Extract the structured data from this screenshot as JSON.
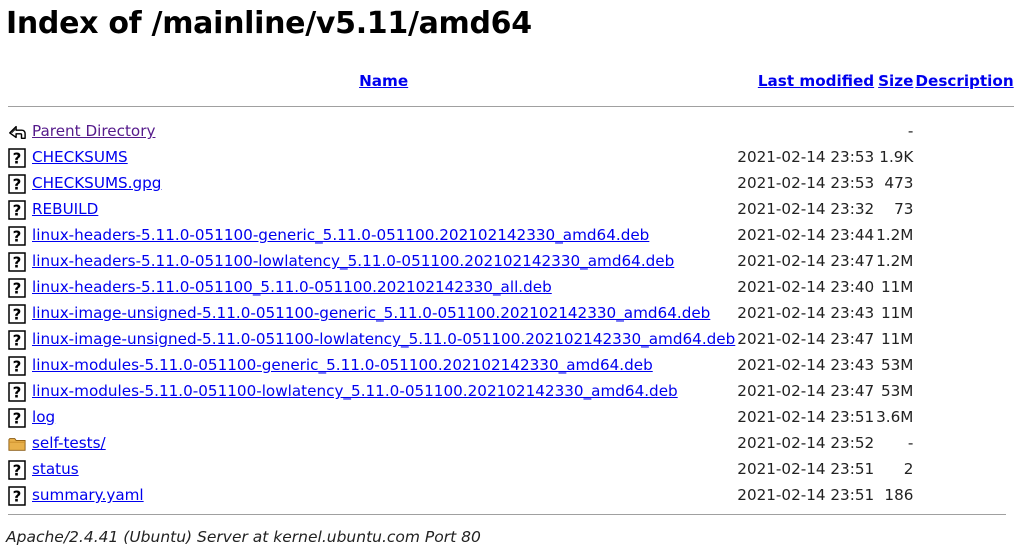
{
  "page": {
    "title": "Index of /mainline/v5.11/amd64"
  },
  "headers": {
    "name": "Name",
    "last_modified": "Last modified",
    "size": "Size",
    "description": "Description"
  },
  "rows": [
    {
      "icon": "back-icon",
      "name": "Parent Directory",
      "modified": "",
      "size": "-"
    },
    {
      "icon": "unknown-file-icon",
      "name": "CHECKSUMS",
      "modified": "2021-02-14 23:53",
      "size": "1.9K"
    },
    {
      "icon": "unknown-file-icon",
      "name": "CHECKSUMS.gpg",
      "modified": "2021-02-14 23:53",
      "size": "473"
    },
    {
      "icon": "unknown-file-icon",
      "name": "REBUILD",
      "modified": "2021-02-14 23:32",
      "size": "73"
    },
    {
      "icon": "unknown-file-icon",
      "name": "linux-headers-5.11.0-051100-generic_5.11.0-051100.202102142330_amd64.deb",
      "modified": "2021-02-14 23:44",
      "size": "1.2M"
    },
    {
      "icon": "unknown-file-icon",
      "name": "linux-headers-5.11.0-051100-lowlatency_5.11.0-051100.202102142330_amd64.deb",
      "modified": "2021-02-14 23:47",
      "size": "1.2M"
    },
    {
      "icon": "unknown-file-icon",
      "name": "linux-headers-5.11.0-051100_5.11.0-051100.202102142330_all.deb",
      "modified": "2021-02-14 23:40",
      "size": "11M"
    },
    {
      "icon": "unknown-file-icon",
      "name": "linux-image-unsigned-5.11.0-051100-generic_5.11.0-051100.202102142330_amd64.deb",
      "modified": "2021-02-14 23:43",
      "size": "11M"
    },
    {
      "icon": "unknown-file-icon",
      "name": "linux-image-unsigned-5.11.0-051100-lowlatency_5.11.0-051100.202102142330_amd64.deb",
      "modified": "2021-02-14 23:47",
      "size": "11M"
    },
    {
      "icon": "unknown-file-icon",
      "name": "linux-modules-5.11.0-051100-generic_5.11.0-051100.202102142330_amd64.deb",
      "modified": "2021-02-14 23:43",
      "size": "53M"
    },
    {
      "icon": "unknown-file-icon",
      "name": "linux-modules-5.11.0-051100-lowlatency_5.11.0-051100.202102142330_amd64.deb",
      "modified": "2021-02-14 23:47",
      "size": "53M"
    },
    {
      "icon": "unknown-file-icon",
      "name": "log",
      "modified": "2021-02-14 23:51",
      "size": "3.6M"
    },
    {
      "icon": "folder-icon",
      "name": "self-tests/",
      "modified": "2021-02-14 23:52",
      "size": "-"
    },
    {
      "icon": "unknown-file-icon",
      "name": "status",
      "modified": "2021-02-14 23:51",
      "size": "2"
    },
    {
      "icon": "unknown-file-icon",
      "name": "summary.yaml",
      "modified": "2021-02-14 23:51",
      "size": "186"
    }
  ],
  "footer": {
    "address": "Apache/2.4.41 (Ubuntu) Server at kernel.ubuntu.com Port 80"
  },
  "colors": {
    "link": "#0000ee",
    "visited_link": "#551a8b",
    "rule": "#a0a0a0",
    "folder": "#e8b04a"
  }
}
